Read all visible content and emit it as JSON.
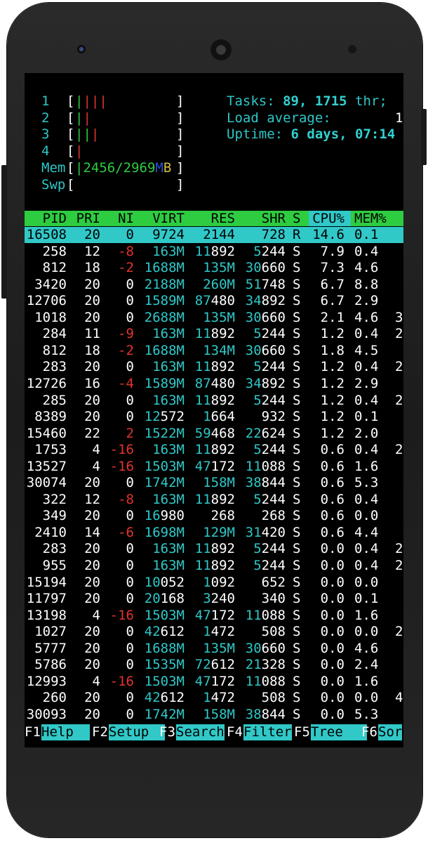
{
  "meters": {
    "cpu": [
      {
        "label": "1",
        "bars": [
          {
            "text": "|",
            "color": "g"
          },
          {
            "text": "|||",
            "color": "r"
          }
        ]
      },
      {
        "label": "2",
        "bars": [
          {
            "text": "|",
            "color": "g"
          },
          {
            "text": "|",
            "color": "r"
          }
        ]
      },
      {
        "label": "3",
        "bars": [
          {
            "text": "||",
            "color": "g"
          },
          {
            "text": "|",
            "color": "r"
          }
        ]
      },
      {
        "label": "4",
        "bars": [
          {
            "text": "|",
            "color": "r"
          }
        ]
      }
    ],
    "mem": {
      "label": "Mem",
      "value": "2456/2969",
      "unit_m": "M",
      "unit_b": "B"
    },
    "swp": {
      "label": "Swp"
    }
  },
  "summary": {
    "tasks_label": "Tasks: ",
    "tasks_value": "89, 1715",
    "tasks_suffix": " thr;",
    "load_label": "Load average:",
    "load_value": "1",
    "uptime_label": "Uptime: ",
    "uptime_value": "6 days, 07:14"
  },
  "table": {
    "headers": [
      "PID",
      "PRI",
      "NI",
      "VIRT",
      "RES",
      "SHR",
      "S",
      "CPU%",
      "MEM%"
    ],
    "rows": [
      [
        "16508",
        "20",
        "0",
        "9724",
        "2144",
        "728",
        "R",
        "14.6",
        "0.1",
        ""
      ],
      [
        "258",
        "12",
        "-8",
        "163M",
        "11892",
        "5244",
        "S",
        "7.9",
        "0.4",
        ""
      ],
      [
        "812",
        "18",
        "-2",
        "1688M",
        "135M",
        "30660",
        "S",
        "7.3",
        "4.6",
        ""
      ],
      [
        "3420",
        "20",
        "0",
        "2188M",
        "260M",
        "51748",
        "S",
        "6.7",
        "8.8",
        ""
      ],
      [
        "12706",
        "20",
        "0",
        "1589M",
        "87480",
        "34892",
        "S",
        "6.7",
        "2.9",
        ""
      ],
      [
        "1018",
        "20",
        "0",
        "2688M",
        "135M",
        "30660",
        "S",
        "2.1",
        "4.6",
        "3"
      ],
      [
        "284",
        "11",
        "-9",
        "163M",
        "11892",
        "5244",
        "S",
        "1.2",
        "0.4",
        "2"
      ],
      [
        "812",
        "18",
        "-2",
        "1688M",
        "134M",
        "30660",
        "S",
        "1.8",
        "4.5",
        ""
      ],
      [
        "283",
        "20",
        "0",
        "163M",
        "11892",
        "5244",
        "S",
        "1.2",
        "0.4",
        "2"
      ],
      [
        "12726",
        "16",
        "-4",
        "1589M",
        "87480",
        "34892",
        "S",
        "1.2",
        "2.9",
        ""
      ],
      [
        "285",
        "20",
        "0",
        "163M",
        "11892",
        "5244",
        "S",
        "1.2",
        "0.4",
        "2"
      ],
      [
        "8389",
        "20",
        "0",
        "12572",
        "1664",
        "932",
        "S",
        "1.2",
        "0.1",
        ""
      ],
      [
        "15460",
        "22",
        "2",
        "1522M",
        "59468",
        "22624",
        "S",
        "1.2",
        "2.0",
        ""
      ],
      [
        "1753",
        "4",
        "-16",
        "163M",
        "11892",
        "5244",
        "S",
        "0.6",
        "0.4",
        "2"
      ],
      [
        "13527",
        "4",
        "-16",
        "1503M",
        "47172",
        "11088",
        "S",
        "0.6",
        "1.6",
        ""
      ],
      [
        "30074",
        "20",
        "0",
        "1742M",
        "158M",
        "38844",
        "S",
        "0.6",
        "5.3",
        ""
      ],
      [
        "322",
        "12",
        "-8",
        "163M",
        "11892",
        "5244",
        "S",
        "0.6",
        "0.4",
        ""
      ],
      [
        "349",
        "20",
        "0",
        "16980",
        "268",
        "268",
        "S",
        "0.6",
        "0.0",
        ""
      ],
      [
        "2410",
        "14",
        "-6",
        "1698M",
        "129M",
        "31420",
        "S",
        "0.6",
        "4.4",
        ""
      ],
      [
        "283",
        "20",
        "0",
        "163M",
        "11892",
        "5244",
        "S",
        "0.0",
        "0.4",
        "2"
      ],
      [
        "955",
        "20",
        "0",
        "163M",
        "11892",
        "5244",
        "S",
        "0.0",
        "0.4",
        "2"
      ],
      [
        "15194",
        "20",
        "0",
        "10052",
        "1092",
        "652",
        "S",
        "0.0",
        "0.0",
        ""
      ],
      [
        "11797",
        "20",
        "0",
        "20168",
        "3240",
        "340",
        "S",
        "0.0",
        "0.1",
        ""
      ],
      [
        "13198",
        "4",
        "-16",
        "1503M",
        "47172",
        "11088",
        "S",
        "0.0",
        "1.6",
        ""
      ],
      [
        "1027",
        "20",
        "0",
        "42612",
        "1472",
        "508",
        "S",
        "0.0",
        "0.0",
        "2"
      ],
      [
        "5777",
        "20",
        "0",
        "1688M",
        "135M",
        "30660",
        "S",
        "0.0",
        "4.6",
        ""
      ],
      [
        "5786",
        "20",
        "0",
        "1535M",
        "72612",
        "21328",
        "S",
        "0.0",
        "2.4",
        ""
      ],
      [
        "12993",
        "4",
        "-16",
        "1503M",
        "47172",
        "11088",
        "S",
        "0.0",
        "1.6",
        ""
      ],
      [
        "260",
        "20",
        "0",
        "42612",
        "1472",
        "508",
        "S",
        "0.0",
        "0.0",
        "4"
      ],
      [
        "30093",
        "20",
        "0",
        "1742M",
        "158M",
        "38844",
        "S",
        "0.0",
        "5.3",
        ""
      ]
    ]
  },
  "function_keys": [
    {
      "key": "F1",
      "label": "Help  "
    },
    {
      "key": "F2",
      "label": "Setup  "
    },
    {
      "key": "F3",
      "label": "Search"
    },
    {
      "key": "F4",
      "label": "Filter"
    },
    {
      "key": "F5",
      "label": "Tree   "
    },
    {
      "key": "F6",
      "label": "Sor"
    }
  ],
  "colors": {
    "cyan": "#31c8c8",
    "green": "#2ecc40",
    "red": "#e0342c",
    "blue": "#2b4fd6",
    "yellow": "#d7c23a"
  }
}
